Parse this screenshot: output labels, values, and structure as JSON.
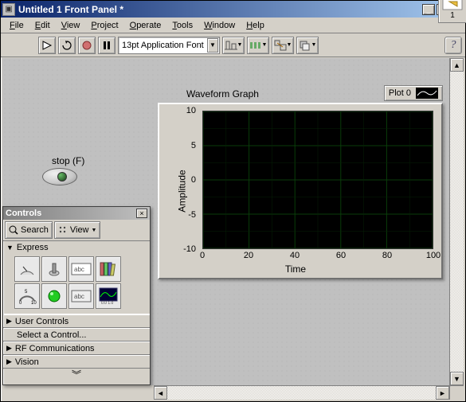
{
  "window": {
    "title": "Untitled 1 Front Panel *",
    "minimize": "_",
    "maximize": "□",
    "close": "×"
  },
  "menu": {
    "file": "File",
    "edit": "Edit",
    "view": "View",
    "project": "Project",
    "operate": "Operate",
    "tools": "Tools",
    "window": "Window",
    "help": "Help"
  },
  "toolbar": {
    "font": "13pt Application Font",
    "help": "?",
    "context_badge": "1"
  },
  "stop": {
    "label": "stop (F)"
  },
  "graph": {
    "title": "Waveform Graph",
    "legend_label": "Plot 0",
    "ylabel": "Amplitude",
    "xlabel": "Time"
  },
  "chart_data": {
    "type": "line",
    "title": "Waveform Graph",
    "xlabel": "Time",
    "ylabel": "Amplitude",
    "xlim": [
      0,
      100
    ],
    "ylim": [
      -10,
      10
    ],
    "x_ticks": [
      0,
      20,
      40,
      60,
      80,
      100
    ],
    "y_ticks": [
      -10,
      -5,
      0,
      5,
      10
    ],
    "series": [
      {
        "name": "Plot 0",
        "x": [],
        "y": []
      }
    ]
  },
  "palette": {
    "title": "Controls",
    "close": "×",
    "search": "Search",
    "view": "View",
    "sections": {
      "express": "Express",
      "user_controls": "User Controls",
      "select": "Select a Control...",
      "rf": "RF Communications",
      "vision": "Vision"
    },
    "expand": "︾"
  },
  "icons": {
    "dial": "◔",
    "slider": "⟂",
    "edit": "abc",
    "books": "▥",
    "gauge": "⟳",
    "led": "●",
    "edit2": "abc",
    "wave": "▦"
  }
}
